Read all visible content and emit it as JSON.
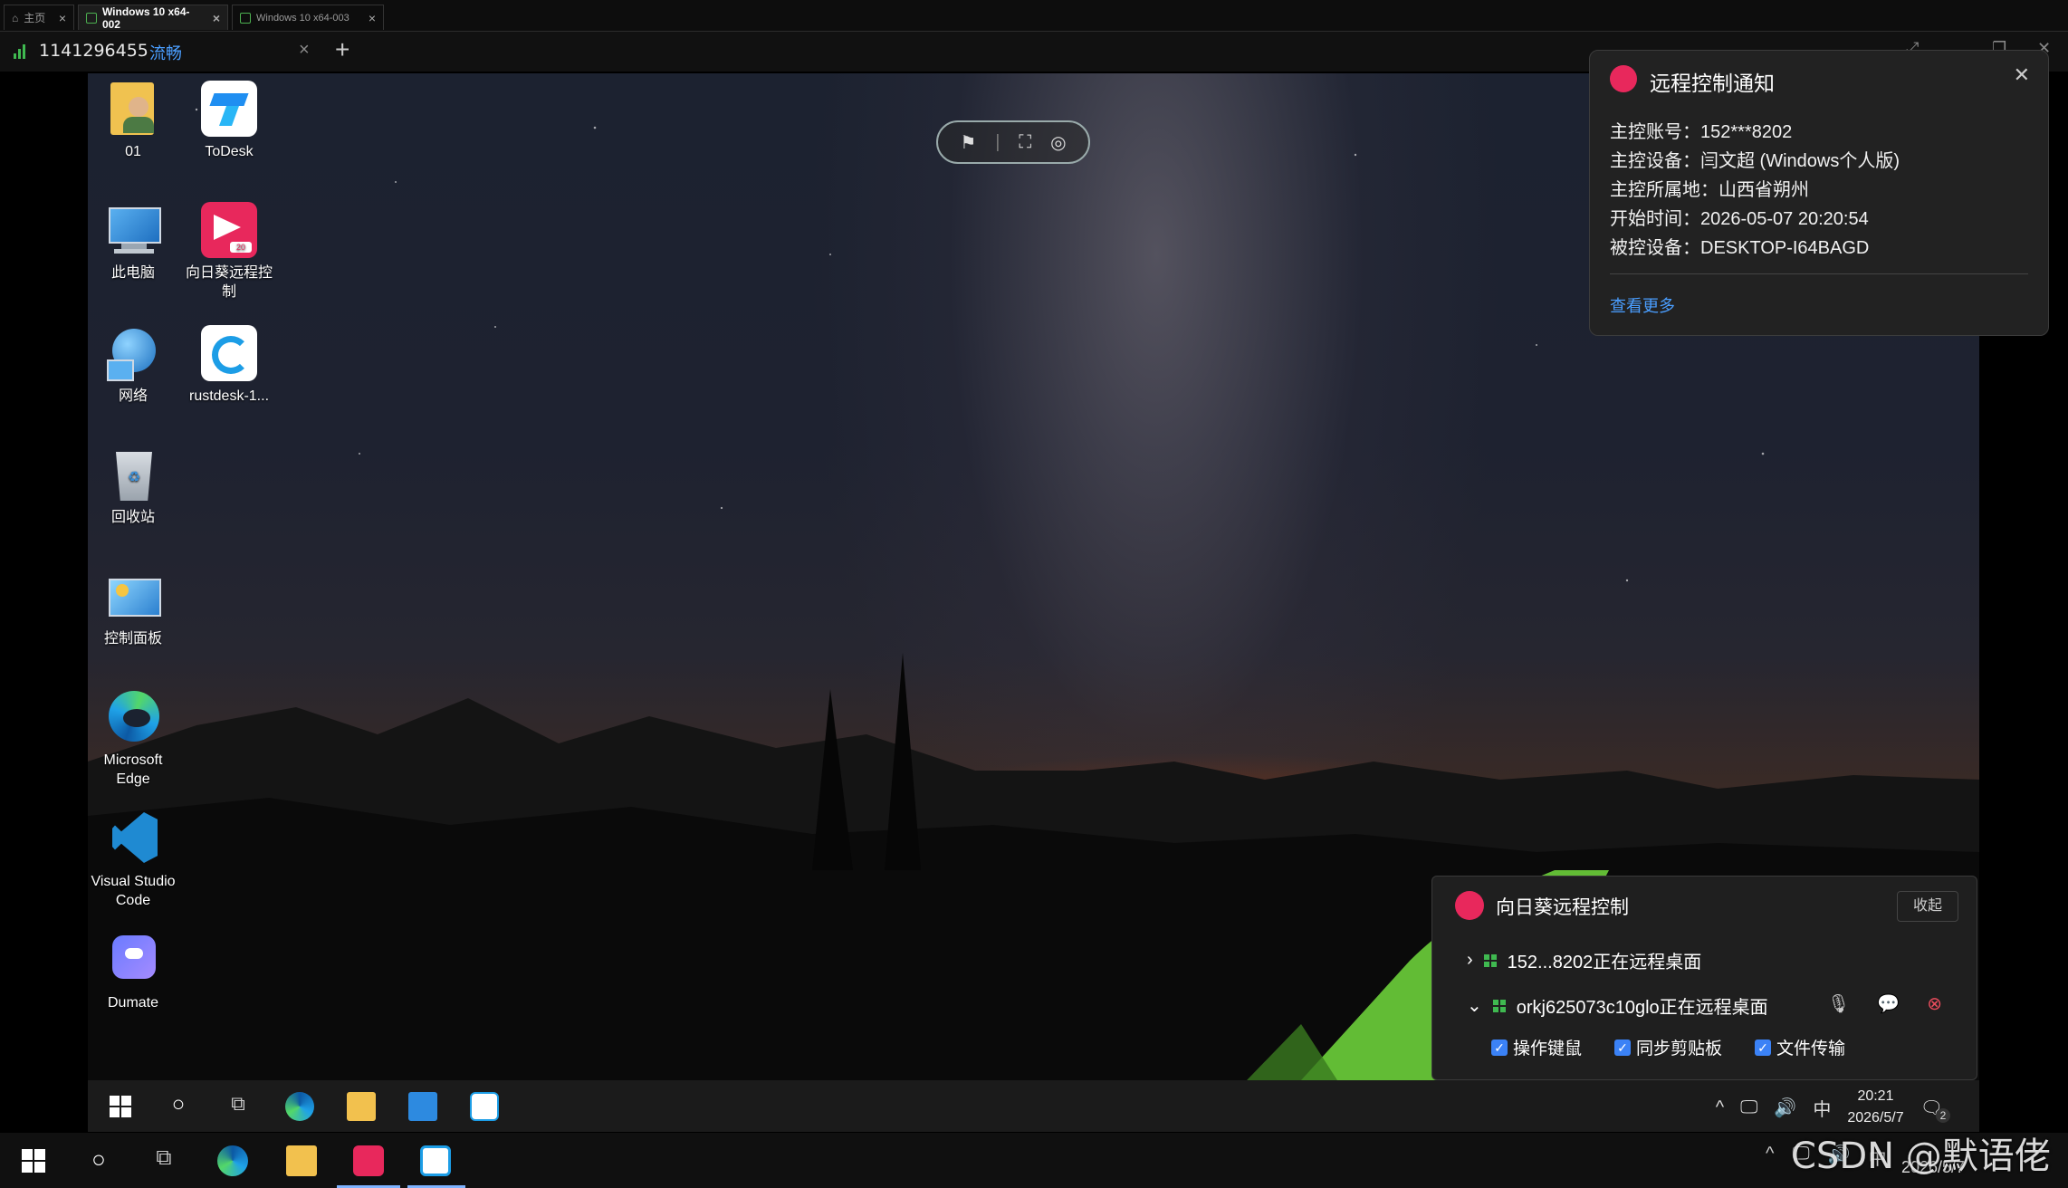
{
  "tabs": [
    {
      "label": "主页"
    },
    {
      "label": "Windows 10 x64-002"
    },
    {
      "label": "Windows 10 x64-003"
    }
  ],
  "session": {
    "id": "1141296455",
    "quality": "流畅",
    "add_label": "+"
  },
  "desktop_icons": [
    {
      "label": "01"
    },
    {
      "label": "ToDesk"
    },
    {
      "label": "此电脑"
    },
    {
      "label": "向日葵远程控制"
    },
    {
      "label": "网络"
    },
    {
      "label": "rustdesk-1..."
    },
    {
      "label": "回收站"
    },
    {
      "label": "控制面板"
    },
    {
      "label": "Microsoft Edge"
    },
    {
      "label": "Visual Studio Code"
    },
    {
      "label": "Dumate"
    }
  ],
  "notification": {
    "title": "远程控制通知",
    "lines": [
      "主控账号：152***8202",
      "主控设备：闫文超 (Windows个人版)",
      "主控所属地：山西省朔州",
      "开始时间：2026-05-07 20:20:54",
      "被控设备：DESKTOP-I64BAGD"
    ],
    "more_link": "查看更多"
  },
  "sunlogin_panel": {
    "title": "向日葵远程控制",
    "collapse_label": "收起",
    "sessions": [
      {
        "text": "152...8202正在远程桌面"
      },
      {
        "text": "orkj625073c10glo正在远程桌面"
      }
    ],
    "options": [
      "操作键鼠",
      "同步剪贴板",
      "文件传输"
    ]
  },
  "remote_taskbar": {
    "ime": "中",
    "time": "20:21",
    "date": "2026/5/7",
    "notif_count": "2"
  },
  "local_taskbar": {
    "ime": "中",
    "date": "2026/5/7"
  },
  "watermark": "CSDN @默语佬",
  "colors": {
    "brand_red": "#e8285c",
    "link_blue": "#4a9eff",
    "signal_green": "#3fb950",
    "check_blue": "#3b82f6"
  }
}
